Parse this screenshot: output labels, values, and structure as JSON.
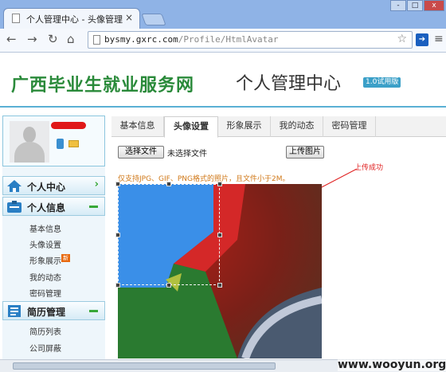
{
  "browser": {
    "tab_title": "个人管理中心 - 头像管理",
    "tab_close": "×",
    "url_host": "bysmy.gxrc.com",
    "url_path": "/Profile/HtmlAvatar",
    "window_controls": [
      "-",
      "□",
      "x"
    ]
  },
  "site": {
    "name": "广西毕业生就业服务网",
    "section": "个人管理中心",
    "version_badge": "1.0试用版",
    "colors": {
      "brand_green": "#2a8a3a",
      "accent_blue": "#5ab0d4"
    }
  },
  "sidebar": {
    "menus": [
      {
        "label": "个人中心",
        "icon": "home-icon",
        "state": "arrow",
        "items": []
      },
      {
        "label": "个人信息",
        "icon": "id-card-icon",
        "state": "expanded",
        "items": [
          "基本信息",
          "头像设置",
          "形象展示",
          "我的动态",
          "密码管理"
        ]
      },
      {
        "label": "简历管理",
        "icon": "resume-icon",
        "state": "expanded",
        "items": [
          "简历列表",
          "公司屏蔽"
        ]
      }
    ],
    "new_tag": "新"
  },
  "main": {
    "tabs": [
      {
        "label": "基本信息",
        "active": false
      },
      {
        "label": "头像设置",
        "active": true
      },
      {
        "label": "形象展示",
        "active": false
      },
      {
        "label": "我的动态",
        "active": false
      },
      {
        "label": "密码管理",
        "active": false
      }
    ],
    "choose_file_label": "选择文件",
    "file_status": "未选择文件",
    "upload_label": "上传图片",
    "hint": "仅支持JPG、GIF、PNG格式的照片，且文件小于2M。",
    "upload_note": "上传成功"
  },
  "watermark": "www.wooyun.org"
}
